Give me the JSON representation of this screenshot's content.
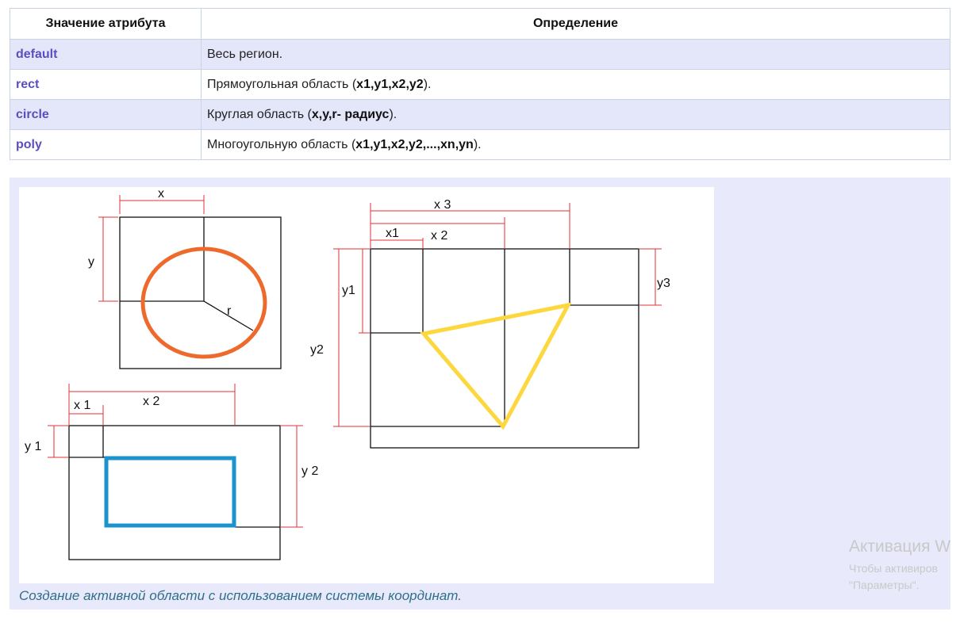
{
  "table": {
    "headers": [
      "Значение атрибута",
      "Определение"
    ],
    "rows": [
      {
        "value": "default",
        "definition_plain": "Весь регион.",
        "definition_bold": "",
        "definition_end": ""
      },
      {
        "value": "rect",
        "definition_plain": "Прямоугольная область (",
        "definition_bold": "x1,y1,x2,y2",
        "definition_end": ")."
      },
      {
        "value": "circle",
        "definition_plain": "Круглая область (",
        "definition_bold": "x,y,r- радиус",
        "definition_end": ")."
      },
      {
        "value": "poly",
        "definition_plain": "Многоугольную область (",
        "definition_bold": "x1,y1,x2,y2,...,xn,yn",
        "definition_end": ")."
      }
    ]
  },
  "diagram": {
    "circle_labels": {
      "x": "x",
      "y": "y",
      "r": "r"
    },
    "rect_labels": {
      "x1": "x 1",
      "x2": "x 2",
      "y1": "y 1",
      "y2": "y 2"
    },
    "poly_labels": {
      "x1": "x1",
      "x2": "x 2",
      "x3": "x 3",
      "y1": "y1",
      "y2": "y2",
      "y3": "y3"
    },
    "colors": {
      "circle": "#ee6a2c",
      "rect": "#1b93cd",
      "poly": "#fcd73e",
      "dimension": "#e0303a"
    }
  },
  "caption": "Создание активной области с использованием системы координат.",
  "watermark": {
    "title": "Активация W",
    "line1": "Чтобы активиров",
    "line2": "\"Параметры\"."
  }
}
